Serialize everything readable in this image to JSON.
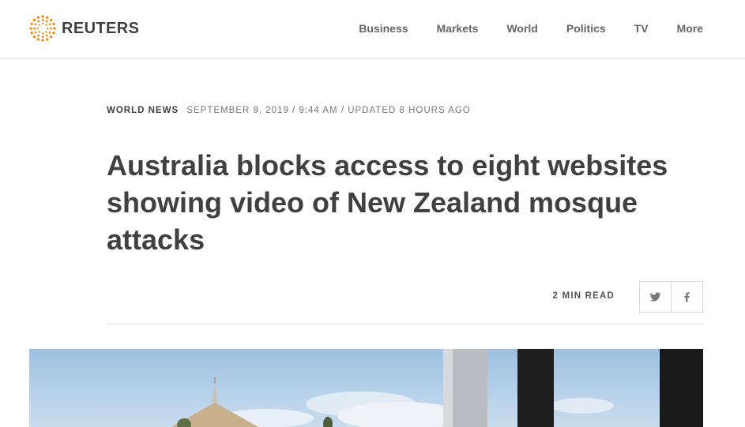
{
  "brand": {
    "name": "REUTERS",
    "logo_icon": "reuters-dot-logo-icon",
    "accent": "#ff8000"
  },
  "nav": {
    "items": [
      "Business",
      "Markets",
      "World",
      "Politics",
      "TV",
      "More"
    ]
  },
  "article": {
    "section": "WORLD NEWS",
    "dateline": "SEPTEMBER 9, 2019 / 9:44 AM / UPDATED 8 HOURS AGO",
    "headline": "Australia blocks access to eight websites showing video of New Zealand mosque attacks",
    "read_time": "2 MIN READ"
  },
  "share": {
    "twitter_icon": "twitter-icon",
    "facebook_icon": "facebook-icon"
  }
}
